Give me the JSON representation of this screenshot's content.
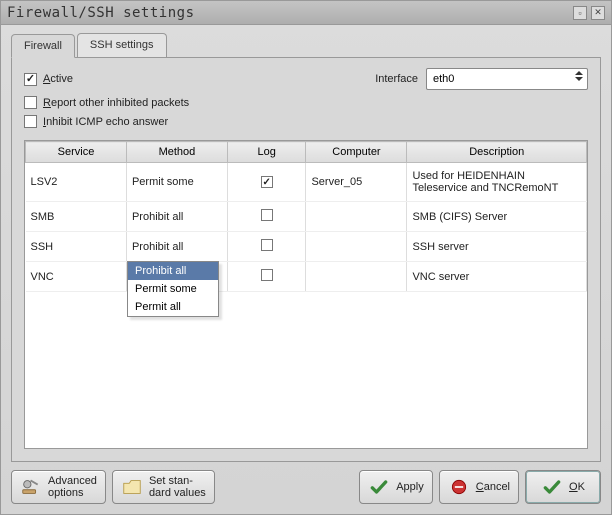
{
  "window": {
    "title": "Firewall/SSH settings"
  },
  "tabs": [
    {
      "label": "Firewall",
      "active": true
    },
    {
      "label": "SSH settings",
      "active": false
    }
  ],
  "checks": {
    "active": {
      "label_pre": "",
      "accel": "A",
      "label_post": "ctive",
      "checked": true
    },
    "report": {
      "label_pre": "",
      "accel": "R",
      "label_post": "eport other inhibited packets",
      "checked": false
    },
    "inhibit": {
      "label_pre": "",
      "accel": "I",
      "label_post": "nhibit ICMP echo answer",
      "checked": false
    }
  },
  "interface": {
    "label": "Interface",
    "value": "eth0"
  },
  "table": {
    "headers": [
      "Service",
      "Method",
      "Log",
      "Computer",
      "Description"
    ],
    "rows": [
      {
        "service": "LSV2",
        "method": "Permit some",
        "log": true,
        "computer": "Server_05",
        "description": "Used for HEIDENHAIN Teleservice and TNCRemoNT"
      },
      {
        "service": "SMB",
        "method": "Prohibit all",
        "log": false,
        "computer": "",
        "description": "SMB (CIFS) Server"
      },
      {
        "service": "SSH",
        "method": "Prohibit all",
        "log": false,
        "computer": "",
        "description": "SSH server"
      },
      {
        "service": "VNC",
        "method": "",
        "log": false,
        "computer": "",
        "description": "VNC server"
      }
    ]
  },
  "dropdown": {
    "options": [
      "Prohibit all",
      "Permit some",
      "Permit all"
    ],
    "selected": 0
  },
  "buttons": {
    "advanced": {
      "line1": "Advanced",
      "line2": "options"
    },
    "standard": {
      "line1": "Set stan-",
      "line2": "dard values"
    },
    "apply": {
      "label": "Apply"
    },
    "cancel": {
      "label_pre": "",
      "accel": "C",
      "label_post": "ancel"
    },
    "ok": {
      "label_pre": "",
      "accel": "O",
      "label_post": "K"
    }
  },
  "colwidths": [
    "18%",
    "18%",
    "14%",
    "18%",
    "32%"
  ]
}
